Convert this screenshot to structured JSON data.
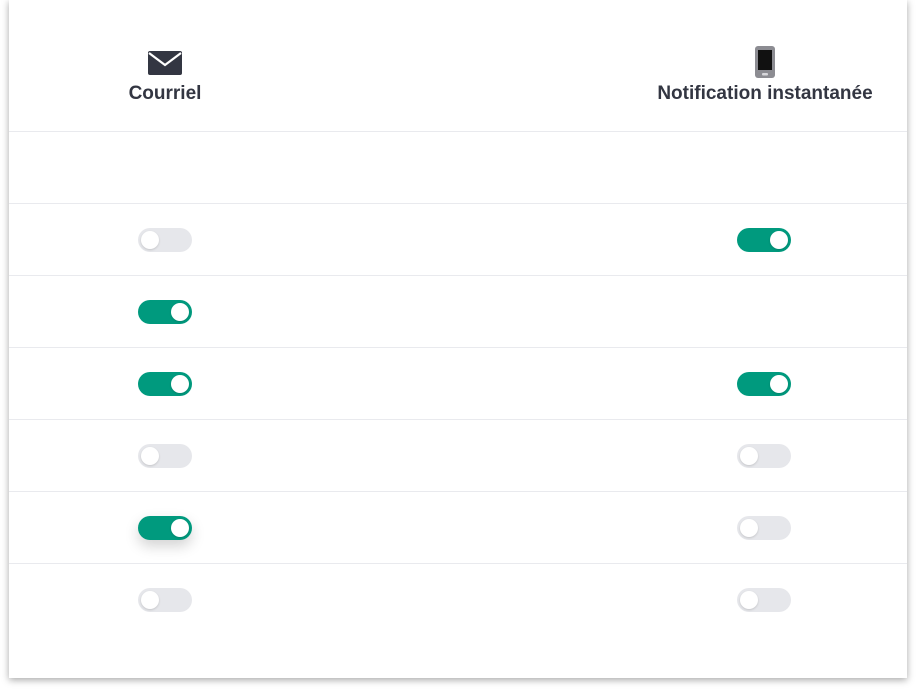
{
  "columns": {
    "email": {
      "label": "Courriel",
      "icon": "envelope-icon"
    },
    "push": {
      "label": "Notification instantanée",
      "icon": "mobile-phone-icon"
    }
  },
  "rows": [
    {
      "email": null,
      "push": null
    },
    {
      "email": false,
      "push": true
    },
    {
      "email": true,
      "push": null
    },
    {
      "email": true,
      "push": true
    },
    {
      "email": false,
      "push": false
    },
    {
      "email": true,
      "push": false
    },
    {
      "email": false,
      "push": false
    }
  ],
  "colors": {
    "toggle_on": "#009a7e",
    "toggle_off": "#e6e7eb",
    "heading_text": "#333642"
  }
}
